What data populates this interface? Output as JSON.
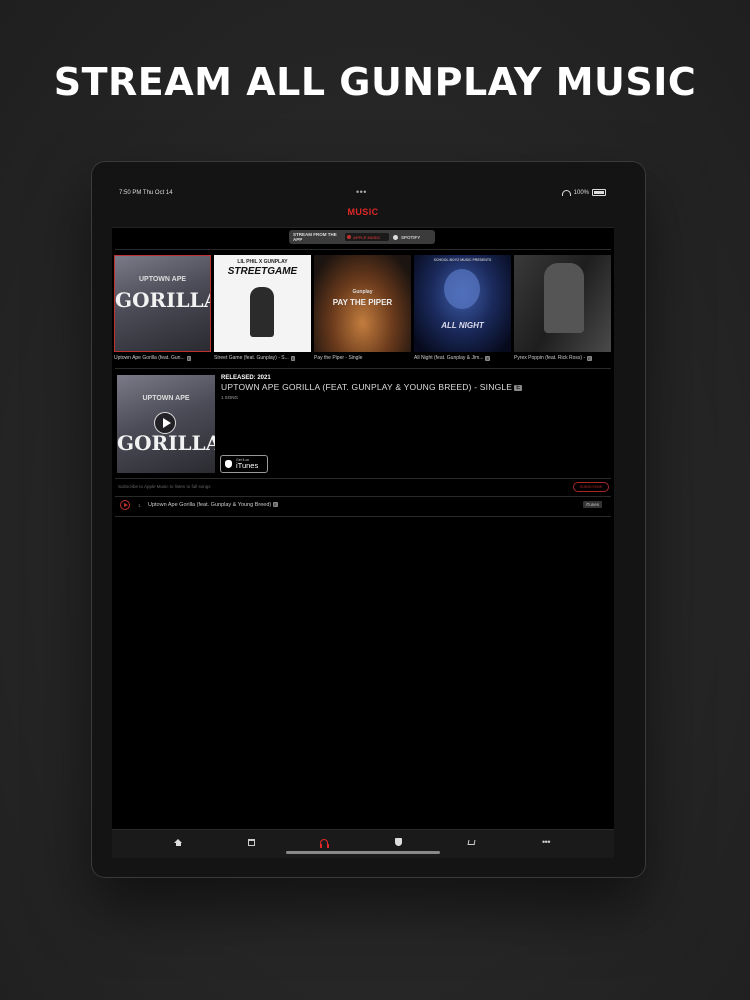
{
  "headline": "STREAM ALL GUNPLAY MUSIC",
  "status_bar": {
    "time": "7:50 PM   Thu Oct 14",
    "battery": "100%",
    "dots": "•••"
  },
  "nav": {
    "title": "MUSIC"
  },
  "stream_toggle": {
    "label": "STREAM FROM THE APP",
    "apple_option": "APPLE MUSIC",
    "spotify_option": "SPOTIFY"
  },
  "albums": [
    {
      "caption": "Uptown Ape Gorilla (feat. Gun...",
      "explicit": "E",
      "cover_text": "GORILLA",
      "cover_sub": "UPTOWN APE"
    },
    {
      "caption": "Street Game (feat. Gunplay) - S...",
      "explicit": "E",
      "cover_text": "STREETGAME",
      "cover_sub": "LIL PHIL X GUNPLAY"
    },
    {
      "caption": "Pay the Piper - Single",
      "explicit": "",
      "cover_text": "PAY THE PIPER",
      "cover_sub": "Gunplay"
    },
    {
      "caption": "All Night (feat. Gunplay & Jim...",
      "explicit": "E",
      "cover_text": "ALL NIGHT",
      "cover_sub": "SCHOOL BOYZ MUSIC PRESENTS"
    },
    {
      "caption": "Pyrex Poppin (feat. Rick Ross) -",
      "explicit": "E",
      "cover_text": "",
      "cover_sub": ""
    }
  ],
  "detail": {
    "released": "RELEASED: 2021",
    "title": "UPTOWN APE GORILLA (FEAT. GUNPLAY & YOUNG BREED) - SINGLE",
    "explicit": "E",
    "song_count": "1 SONG",
    "cover_text": "GORILLA",
    "cover_sub": "UPTOWN APE",
    "itunes_small": "Get it on",
    "itunes_big": "iTunes"
  },
  "subscribe": {
    "message": "Subscribe to Apple Music to listen to full songs",
    "button": "SUBSCRIBE"
  },
  "tracks": [
    {
      "number": "1",
      "name": "Uptown Ape Gorilla (feat. Gunplay & Young Breed)",
      "explicit": "E",
      "store": "iTunes"
    }
  ],
  "tabs": [
    {
      "name": "home",
      "icon": "home-icon"
    },
    {
      "name": "events",
      "icon": "calendar-icon"
    },
    {
      "name": "music",
      "icon": "headphones-icon"
    },
    {
      "name": "badge",
      "icon": "shield-icon"
    },
    {
      "name": "store",
      "icon": "cart-icon"
    },
    {
      "name": "more",
      "icon": "more-icon",
      "glyph": "•••"
    }
  ],
  "colors": {
    "accent": "#e02828",
    "background": "#000000",
    "bar": "#141414"
  }
}
